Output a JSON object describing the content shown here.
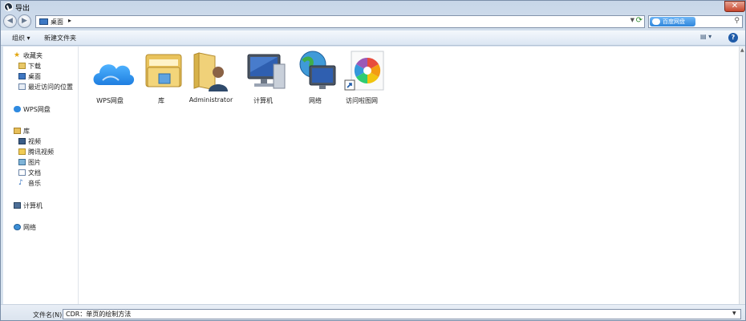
{
  "window": {
    "title": "导出"
  },
  "address": {
    "location": "桌面"
  },
  "search": {
    "provider_label": "百度网盘"
  },
  "toolbar": {
    "organize_label": "组织 ▾",
    "new_folder_label": "新建文件夹"
  },
  "navigation": {
    "items": [
      {
        "label": "收藏夹",
        "icon": "star-icon",
        "level": 0
      },
      {
        "label": "下载",
        "icon": "downloads-folder-icon",
        "level": 1
      },
      {
        "label": "桌面",
        "icon": "desktop-icon",
        "level": 1
      },
      {
        "label": "最近访问的位置",
        "icon": "recent-places-icon",
        "level": 1
      },
      {
        "label": "WPS网盘",
        "icon": "cloud-icon",
        "level": 0
      },
      {
        "label": "库",
        "icon": "library-icon",
        "level": 0
      },
      {
        "label": "视频",
        "icon": "videos-icon",
        "level": 1
      },
      {
        "label": "腾讯视频",
        "icon": "tencent-video-icon",
        "level": 1
      },
      {
        "label": "图片",
        "icon": "pictures-icon",
        "level": 1
      },
      {
        "label": "文档",
        "icon": "documents-icon",
        "level": 1
      },
      {
        "label": "音乐",
        "icon": "music-icon",
        "level": 1
      },
      {
        "label": "计算机",
        "icon": "computer-icon",
        "level": 0
      },
      {
        "label": "网络",
        "icon": "network-icon",
        "level": 0
      }
    ]
  },
  "content": {
    "items": [
      {
        "label": "WPS网盘",
        "icon": "wps-cloud-icon"
      },
      {
        "label": "库",
        "icon": "library-folder-icon"
      },
      {
        "label": "Administrator",
        "icon": "user-folder-icon"
      },
      {
        "label": "计算机",
        "icon": "computer-icon"
      },
      {
        "label": "网络",
        "icon": "network-globe-icon"
      },
      {
        "label": "访问啦图网",
        "icon": "web-shortcut-icon"
      }
    ]
  },
  "bottom": {
    "filename_label": "文件名(N):",
    "filename_value": "CDR：单页的绘制方法"
  },
  "colors": {
    "accent": "#3d78c4",
    "close_red": "#c7452c"
  }
}
